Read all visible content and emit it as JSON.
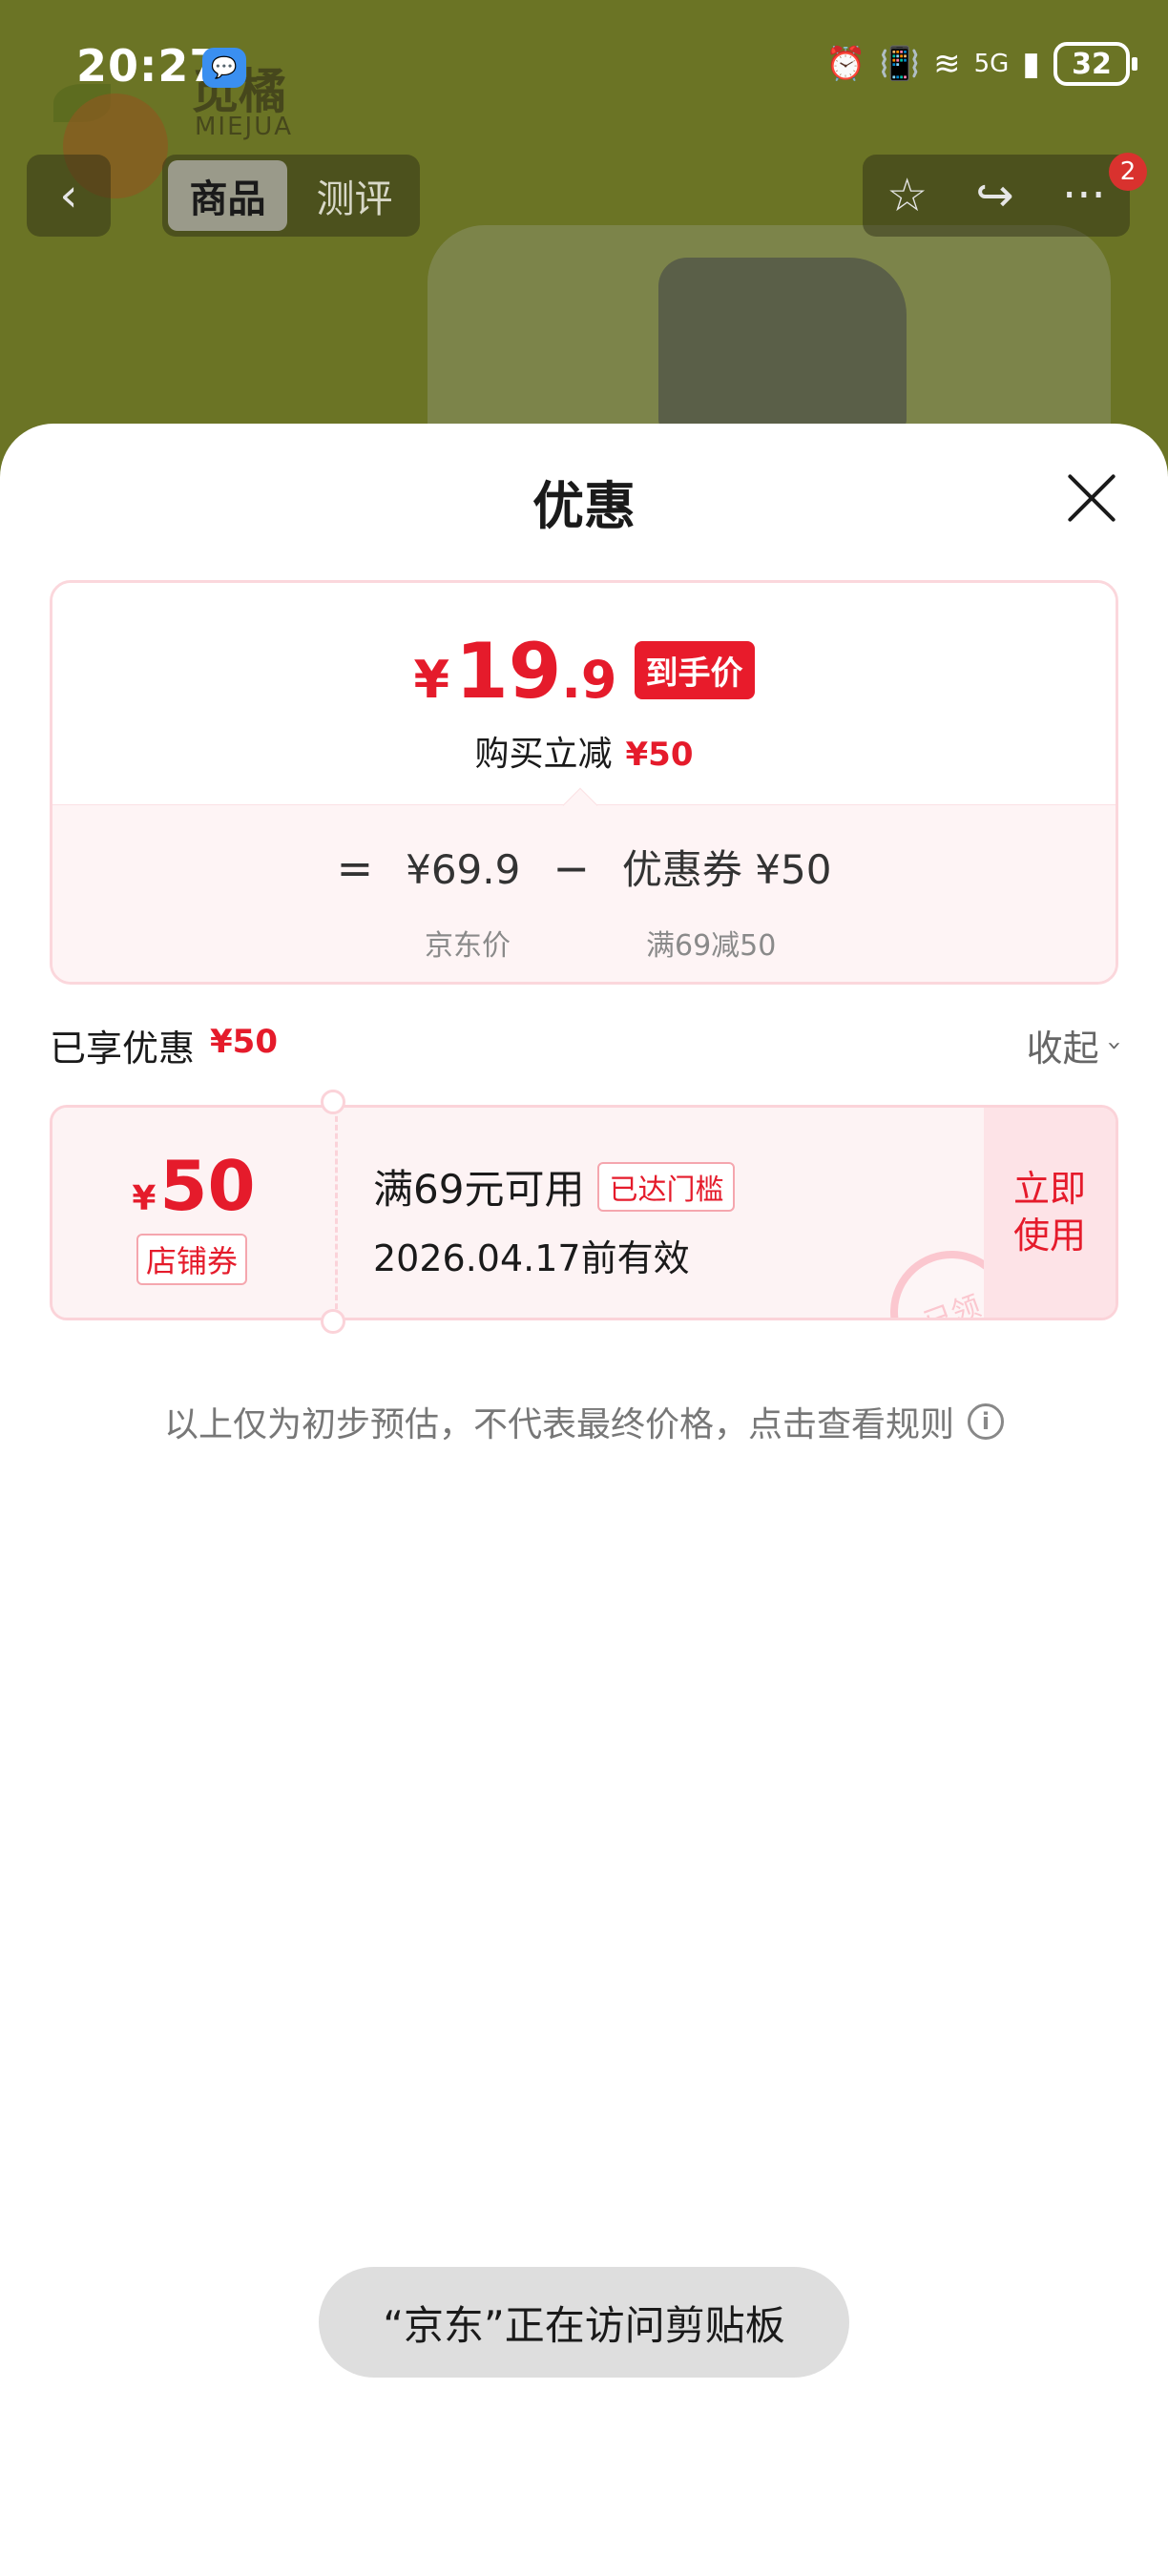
{
  "status_bar": {
    "time": "20:27",
    "network": "5G",
    "battery": "32"
  },
  "background_page": {
    "brand_name": "觅橘",
    "brand_en": "MIEJUA",
    "tabs": [
      {
        "label": "商品",
        "active": true
      },
      {
        "label": "测评",
        "active": false
      }
    ],
    "badge_count": "2"
  },
  "sheet": {
    "title": "优惠",
    "final_price": {
      "currency": "¥",
      "integer": "19",
      "decimal": ".9",
      "tag": "到手价"
    },
    "reduction": {
      "label": "购买立减",
      "amount": "¥50"
    },
    "formula": {
      "equals": "=",
      "base_price": "¥69.9",
      "minus": "−",
      "coupon_part": "优惠券 ¥50",
      "base_label": "京东价",
      "coupon_label": "满69减50"
    },
    "enjoyed": {
      "label": "已享优惠",
      "amount": "¥50",
      "collapse_label": "收起"
    },
    "coupon": {
      "currency": "¥",
      "amount": "50",
      "type": "店铺券",
      "condition": "满69元可用",
      "reached_tag": "已达门槛",
      "validity": "2026.04.17前有效",
      "action_line1": "立即",
      "action_line2": "使用",
      "stamp": "已领"
    },
    "note": "以上仅为初步预估，不代表最终价格，点击查看规则"
  },
  "toast": {
    "text": "“京东”正在访问剪贴板"
  },
  "colors": {
    "accent_red": "#e51b2b",
    "background_olive": "#6b7425"
  }
}
